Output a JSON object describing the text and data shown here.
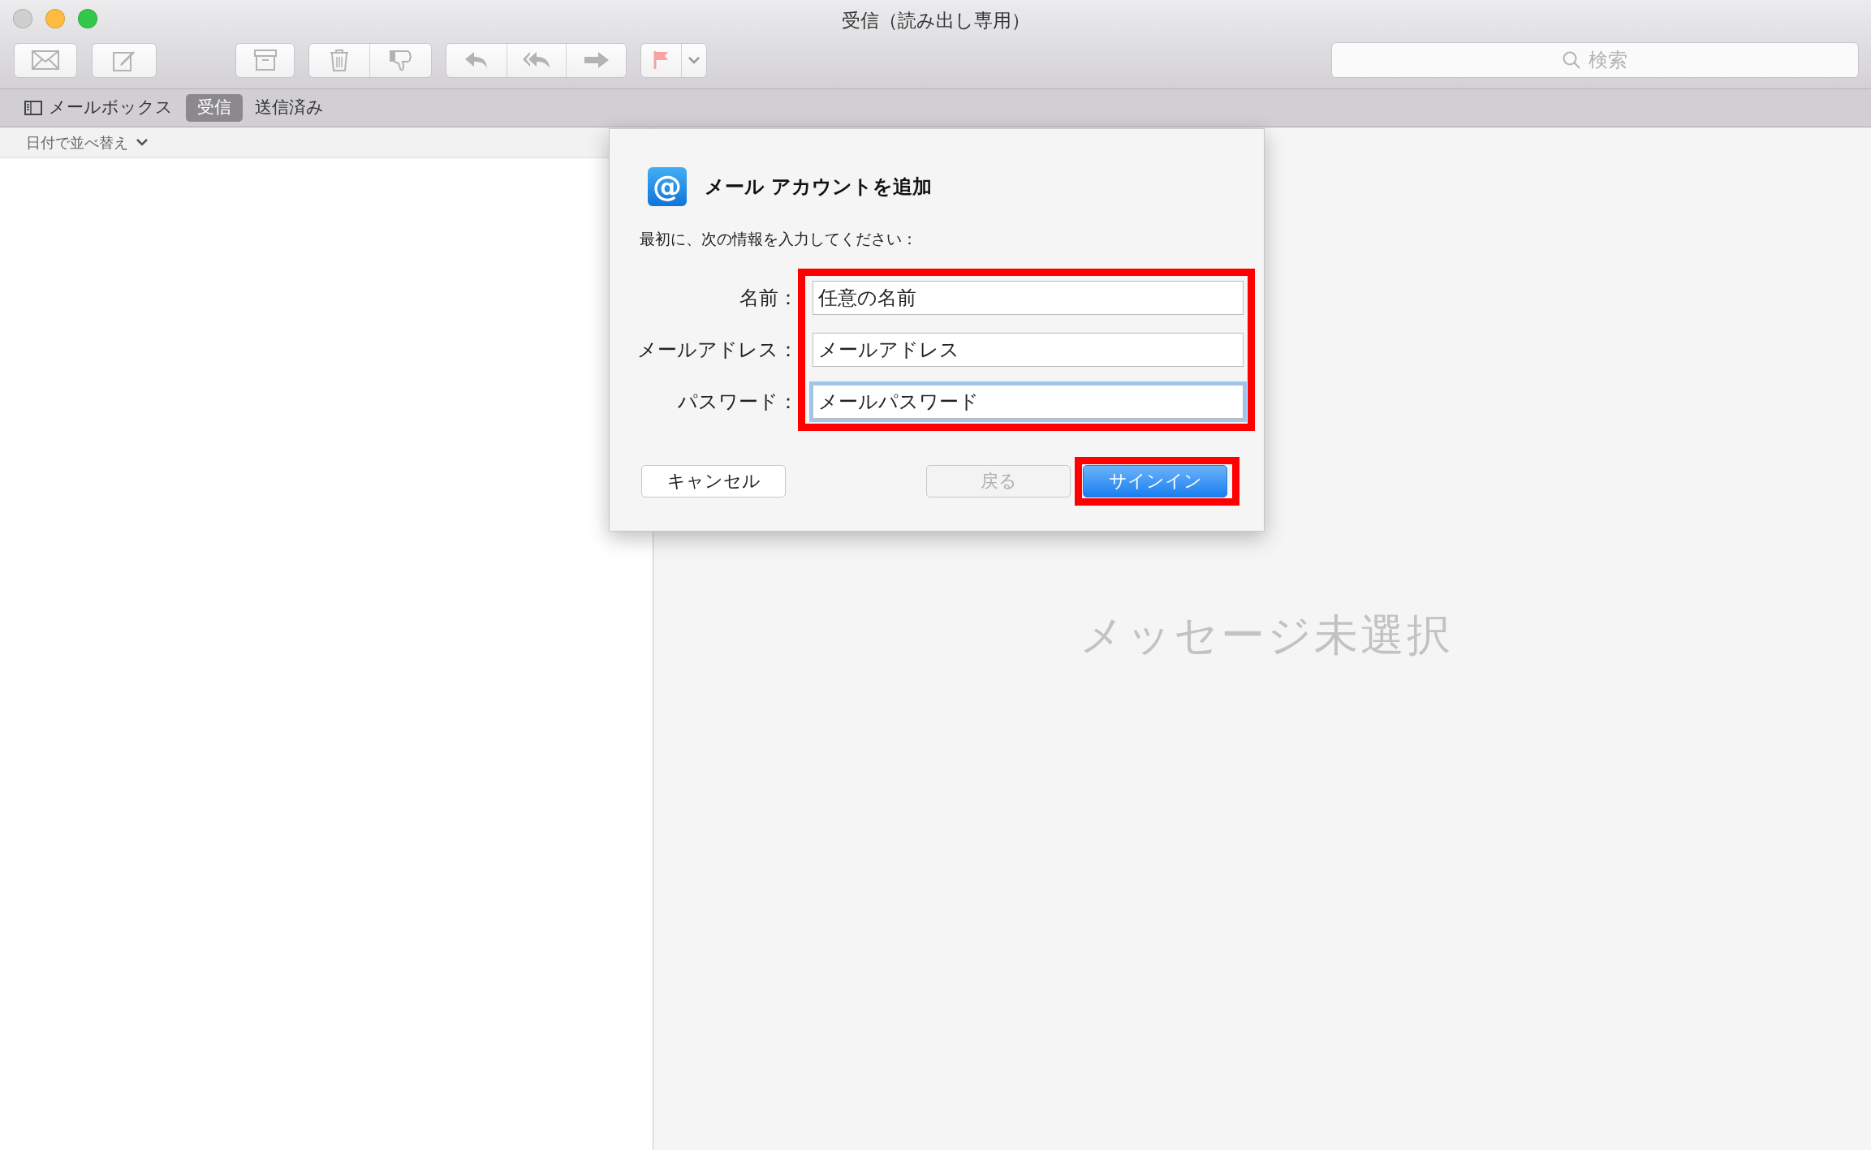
{
  "window": {
    "title": "受信（読み出し専用）"
  },
  "toolbar": {
    "search": {
      "placeholder": "検索"
    }
  },
  "tab_bar": {
    "mailboxes_label": "メールボックス",
    "tabs": [
      {
        "label": "受信",
        "selected": true
      },
      {
        "label": "送信済み",
        "selected": false
      }
    ]
  },
  "message_list": {
    "sort_label": "日付で並べ替え"
  },
  "viewer": {
    "empty_message": "メッセージ未選択"
  },
  "dialog": {
    "icon": "@",
    "title": "メール アカウントを追加",
    "instructions": "最初に、次の情報を入力してください：",
    "fields_highlighted": true,
    "fields": [
      {
        "label": "名前：",
        "value": "任意の名前",
        "focused": false
      },
      {
        "label": "メールアドレス：",
        "value": "メールアドレス",
        "focused": false
      },
      {
        "label": "パスワード：",
        "value": "メールパスワード",
        "focused": true
      }
    ],
    "buttons": [
      {
        "label": "キャンセル",
        "kind": "default",
        "disabled": false,
        "highlighted": false
      },
      {
        "label": "戻る",
        "kind": "default",
        "disabled": true,
        "highlighted": false
      },
      {
        "label": "サインイン",
        "kind": "primary",
        "disabled": false,
        "highlighted": true
      }
    ]
  }
}
